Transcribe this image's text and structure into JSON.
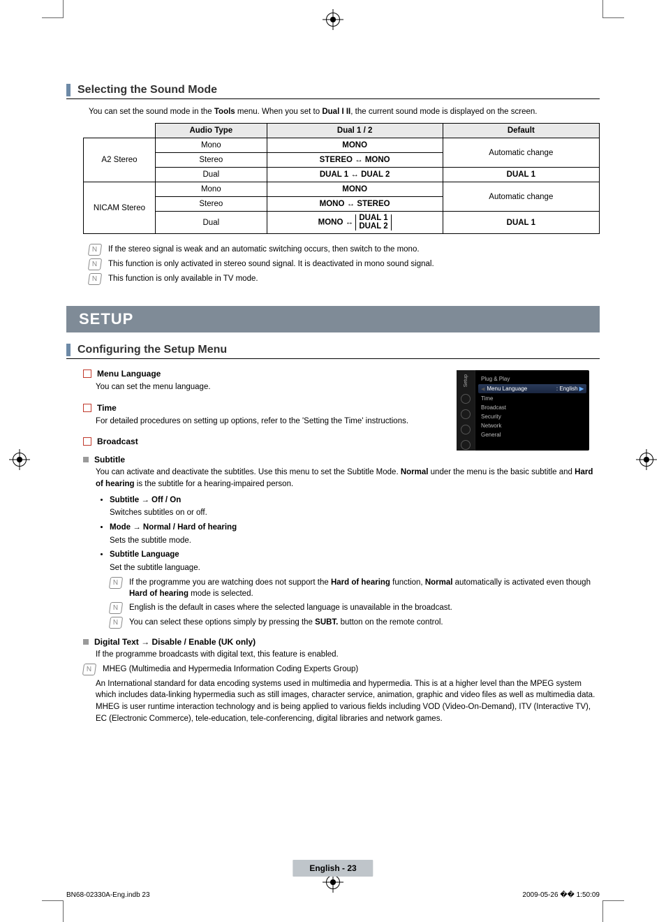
{
  "section1": {
    "title": "Selecting the Sound Mode",
    "intro_pre": "You can set the sound mode in the ",
    "intro_b1": "Tools",
    "intro_mid": " menu. When you set to ",
    "intro_b2": "Dual I II",
    "intro_post": ", the current sound mode is displayed on the screen.",
    "table": {
      "headers": [
        "Audio Type",
        "Dual 1 / 2",
        "Default"
      ],
      "groups": [
        {
          "group": "A2 Stereo",
          "rows": [
            {
              "type": "Mono",
              "dual": "MONO",
              "default": "Automatic change",
              "default_rowspan": 2
            },
            {
              "type": "Stereo",
              "dual": "STEREO ↔ MONO"
            },
            {
              "type": "Dual",
              "dual": "DUAL 1 ↔ DUAL 2",
              "default": "DUAL 1"
            }
          ]
        },
        {
          "group": "NICAM Stereo",
          "rows": [
            {
              "type": "Mono",
              "dual": "MONO",
              "default": "Automatic change",
              "default_rowspan": 2
            },
            {
              "type": "Stereo",
              "dual": "MONO ↔ STEREO"
            },
            {
              "type": "Dual",
              "dual": "MONO ↔ DUAL 1 / DUAL 2",
              "default": "DUAL 1",
              "stacked": true
            }
          ]
        }
      ]
    },
    "notes": [
      "If the stereo signal is weak and an automatic switching occurs, then switch to the mono.",
      "This function is only activated in stereo sound signal. It is deactivated in mono sound signal.",
      "This function is only available in TV mode."
    ]
  },
  "banner": "SETUP",
  "section2": {
    "title": "Configuring the Setup Menu",
    "menu_language": {
      "title": "Menu Language",
      "desc": "You can set the menu language."
    },
    "time": {
      "title": "Time",
      "desc": "For detailed procedures on setting up options, refer to the 'Setting the Time' instructions."
    },
    "broadcast": {
      "title": "Broadcast",
      "subtitle": {
        "title": "Subtitle",
        "desc_pre": "You can activate and deactivate the subtitles. Use this menu to set the Subtitle Mode. ",
        "desc_b1": "Normal",
        "desc_mid": " under the menu is the basic subtitle and ",
        "desc_b2": "Hard of hearing",
        "desc_post": " is the subtitle for a hearing-impaired person.",
        "bullets": [
          {
            "lead": "Subtitle → Off / On",
            "sub": "Switches subtitles on or off."
          },
          {
            "lead": "Mode → Normal / Hard of hearing",
            "sub": "Sets the subtitle mode."
          },
          {
            "lead": "Subtitle Language",
            "sub": "Set the subtitle language."
          }
        ],
        "sub_notes": [
          {
            "pre": "If the programme you are watching does not support the ",
            "b1": "Hard of hearing",
            "mid": " function, ",
            "b2": "Normal",
            "post": " automatically is activated even though ",
            "b3": "Hard of hearing",
            "tail": " mode is selected."
          },
          {
            "text": "English is the default in cases where the selected language is unavailable in the broadcast."
          },
          {
            "pre": "You can select these options simply by pressing the ",
            "b1": "SUBT.",
            "post": " button on the remote control."
          }
        ]
      },
      "digital_text": {
        "title": "Digital Text → Disable / Enable (UK only)",
        "desc": "If the programme broadcasts with digital text, this feature is enabled.",
        "note_lead": "MHEG (Multimedia and Hypermedia Information Coding Experts Group)",
        "note_body": "An International standard for data encoding systems used in multimedia and hypermedia. This is at a higher level than the MPEG system which includes data-linking hypermedia such as still images, character service, animation, graphic and video files as well as multimedia data. MHEG is user runtime interaction technology and is being applied to various fields including VOD (Video-On-Demand), ITV (Interactive TV), EC (Electronic Commerce), tele-education, tele-conferencing, digital libraries and network games."
      }
    }
  },
  "osd": {
    "side_label": "Setup",
    "items": [
      {
        "label": "Plug & Play"
      },
      {
        "label": "Menu Language",
        "value": ": English",
        "hl": true
      },
      {
        "label": "Time"
      },
      {
        "label": "Broadcast"
      },
      {
        "label": "Security"
      },
      {
        "label": "Network"
      },
      {
        "label": "General"
      }
    ]
  },
  "footer": {
    "page": "English - 23",
    "left": "BN68-02330A-Eng.indb   23",
    "right": "2009-05-26   �� 1:50:09"
  }
}
